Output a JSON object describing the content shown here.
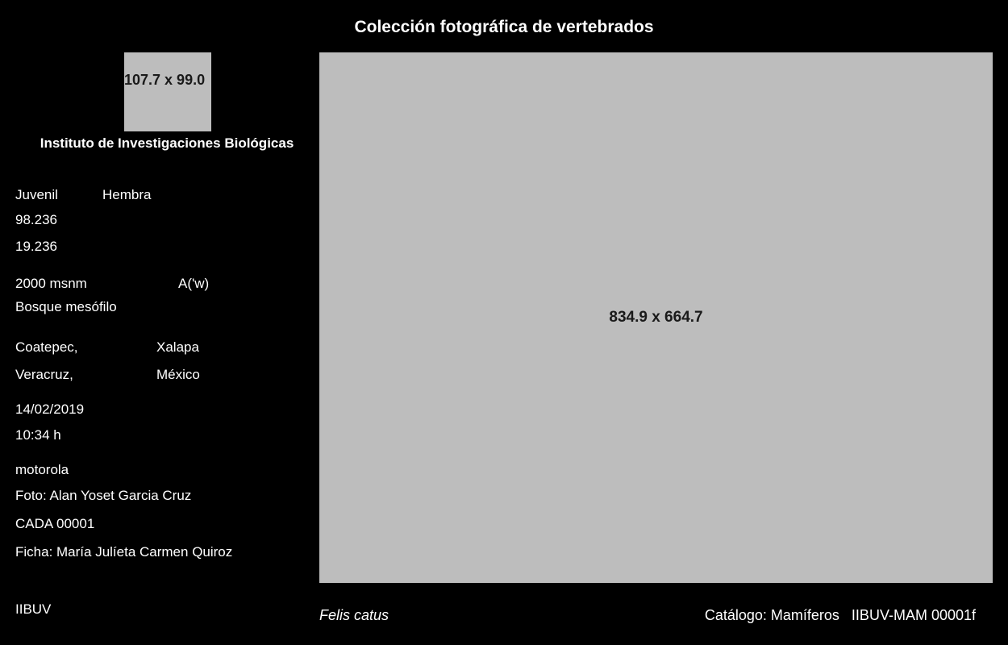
{
  "header": {
    "title": "Colección fotográfica de vertebrados"
  },
  "logo": {
    "placeholder_text": "107.7 x 99.0"
  },
  "sidebar": {
    "institute": "Instituto de Investigaciones Biológicas",
    "age": "Juvenil",
    "sex": "Hembra",
    "longitude": "98.236",
    "latitude": "19.236",
    "altitude": "2000 msnm",
    "climate": "A('w)",
    "vegetation": "Bosque mesófilo",
    "locality": "Coatepec,",
    "municipality": "Xalapa",
    "state": "Veracruz,",
    "country": "México",
    "date": "14/02/2019",
    "time": "10:34 h",
    "camera": "motorola",
    "photographer": "Foto: Alan Yoset Garcia Cruz",
    "collection_id": "CADA 00001",
    "record_author": "Ficha: María Julíeta Carmen Quiroz",
    "organization": "IIBUV"
  },
  "photo": {
    "placeholder_text": "834.9 x 664.7"
  },
  "footer": {
    "species": "Felis catus",
    "catalog": "Catálogo: Mamíferos   IIBUV-MAM 00001f"
  },
  "colors": {
    "background": "#000000",
    "text": "#ffffff",
    "placeholder": "#bdbdbd"
  }
}
